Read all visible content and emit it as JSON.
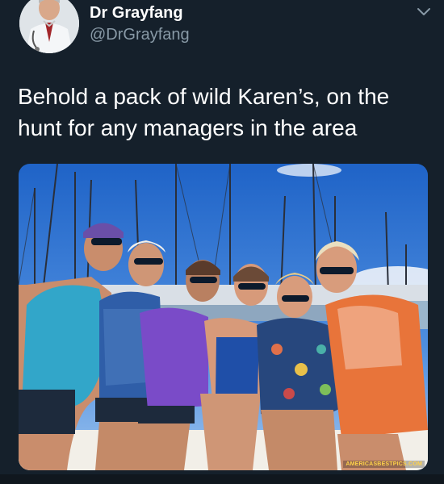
{
  "tweet": {
    "author_name": "Dr Grayfang",
    "author_handle": "@DrGrayfang",
    "text": "Behold a pack of wild Karen’s, on the hunt for any managers in the area"
  },
  "icons": {
    "menu": "chevron-down-icon",
    "avatar": "avatar-doctor"
  },
  "watermark": "AMERICASBESTPICS.COM",
  "colors": {
    "background": "#15202b",
    "text_primary": "#ffffff",
    "text_secondary": "#8899a6"
  }
}
